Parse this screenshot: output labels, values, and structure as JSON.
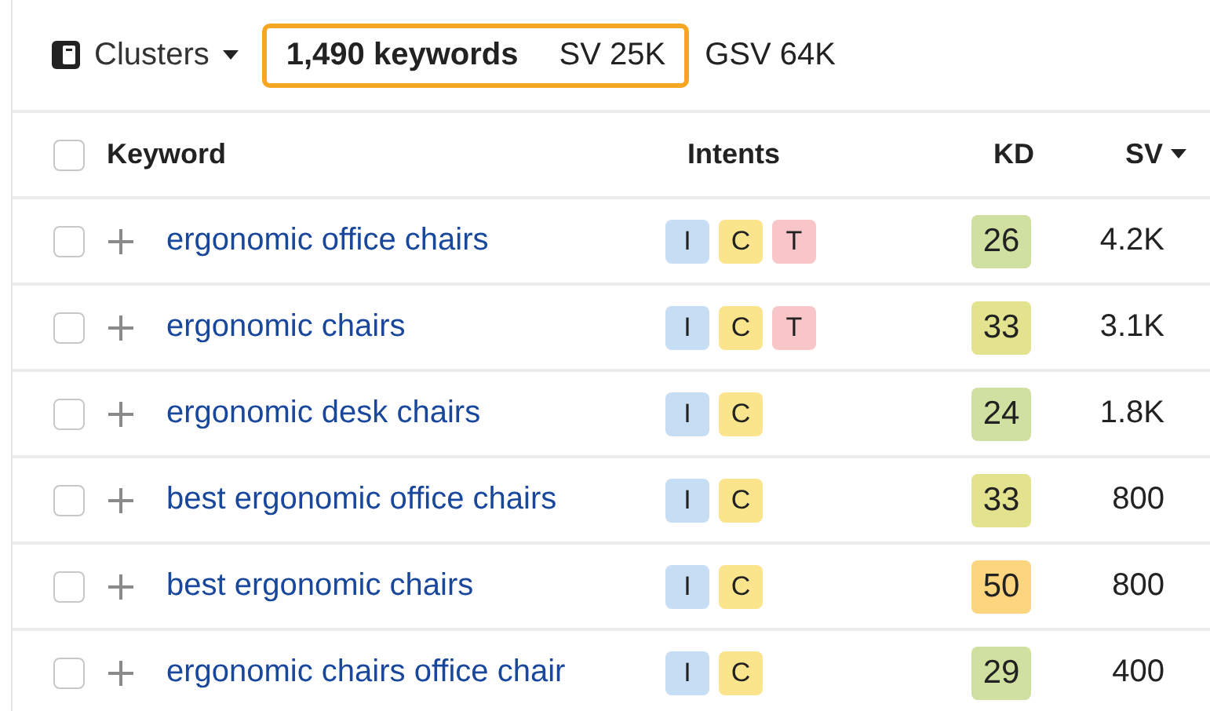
{
  "toolbar": {
    "view": "Clusters",
    "keywords": "1,490 keywords",
    "sv": "SV 25K",
    "gsv": "GSV 64K"
  },
  "table": {
    "select_all_checked": false,
    "columns": [
      {
        "label": "Keyword",
        "sorted": false
      },
      {
        "label": "Intents",
        "sorted": false
      },
      {
        "label": "KD",
        "sorted": false
      },
      {
        "label": "SV",
        "sorted": true
      }
    ],
    "rows": [
      {
        "checked": false,
        "keyword": "ergonomic office chairs",
        "intents": [
          {
            "label": "I",
            "color": "#c6ddf3"
          },
          {
            "label": "C",
            "color": "#fbe58c"
          },
          {
            "label": "T",
            "color": "#f8c6c8"
          }
        ],
        "kd": {
          "value": "26",
          "color": "#cfe0a0"
        },
        "sv": "4.2K"
      },
      {
        "checked": false,
        "keyword": "ergonomic chairs",
        "intents": [
          {
            "label": "I",
            "color": "#c6ddf3"
          },
          {
            "label": "C",
            "color": "#fbe58c"
          },
          {
            "label": "T",
            "color": "#f8c6c8"
          }
        ],
        "kd": {
          "value": "33",
          "color": "#e3e28e"
        },
        "sv": "3.1K"
      },
      {
        "checked": false,
        "keyword": "ergonomic desk chairs",
        "intents": [
          {
            "label": "I",
            "color": "#c6ddf3"
          },
          {
            "label": "C",
            "color": "#fbe58c"
          }
        ],
        "kd": {
          "value": "24",
          "color": "#cfe0a0"
        },
        "sv": "1.8K"
      },
      {
        "checked": false,
        "keyword": "best ergonomic office chairs",
        "intents": [
          {
            "label": "I",
            "color": "#c6ddf3"
          },
          {
            "label": "C",
            "color": "#fbe58c"
          }
        ],
        "kd": {
          "value": "33",
          "color": "#e3e28e"
        },
        "sv": "800"
      },
      {
        "checked": false,
        "keyword": "best ergonomic chairs",
        "intents": [
          {
            "label": "I",
            "color": "#c6ddf3"
          },
          {
            "label": "C",
            "color": "#fbe58c"
          }
        ],
        "kd": {
          "value": "50",
          "color": "#fdd57f"
        },
        "sv": "800"
      },
      {
        "checked": false,
        "keyword": "ergonomic chairs office chair",
        "intents": [
          {
            "label": "I",
            "color": "#c6ddf3"
          },
          {
            "label": "C",
            "color": "#fbe58c"
          }
        ],
        "kd": {
          "value": "29",
          "color": "#cfe0a0"
        },
        "sv": "400"
      }
    ]
  }
}
